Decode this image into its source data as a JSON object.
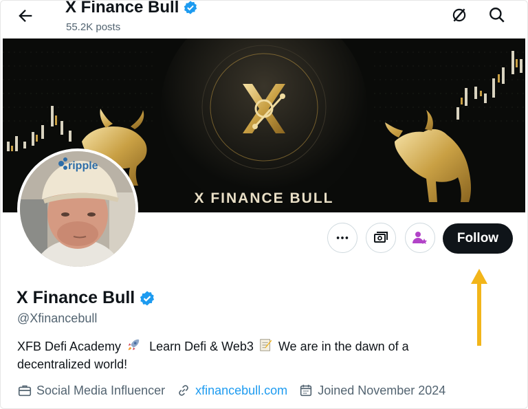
{
  "header": {
    "title": "X Finance Bull",
    "posts": "55.2K posts",
    "icons": [
      "back-arrow-icon",
      "grok-icon",
      "search-icon"
    ]
  },
  "banner": {
    "title_text": "X FINANCE BULL",
    "logo_icon": "xfb-logo-icon"
  },
  "avatar": {
    "cap_text": "ripple"
  },
  "actions": {
    "more_icon": "more-dots-icon",
    "tip_icon": "money-icon",
    "subscribe_icon": "person-star-icon",
    "follow_label": "Follow"
  },
  "profile": {
    "name": "X Finance Bull",
    "handle": "@Xfinancebull",
    "bio_part1": "XFB Defi Academy",
    "bio_part2": "Learn Defi & Web3",
    "bio_part3": "We are in the dawn of a decentralized world!",
    "category": "Social Media Influencer",
    "website": "xfinancebull.com",
    "joined": "Joined November 2024"
  },
  "colors": {
    "verified": "#1d9bf0",
    "follow_bg": "#0f1419",
    "link": "#1d9bf0",
    "annotation_arrow": "#f2b51a",
    "subscribe_accent": "#b243c8"
  }
}
